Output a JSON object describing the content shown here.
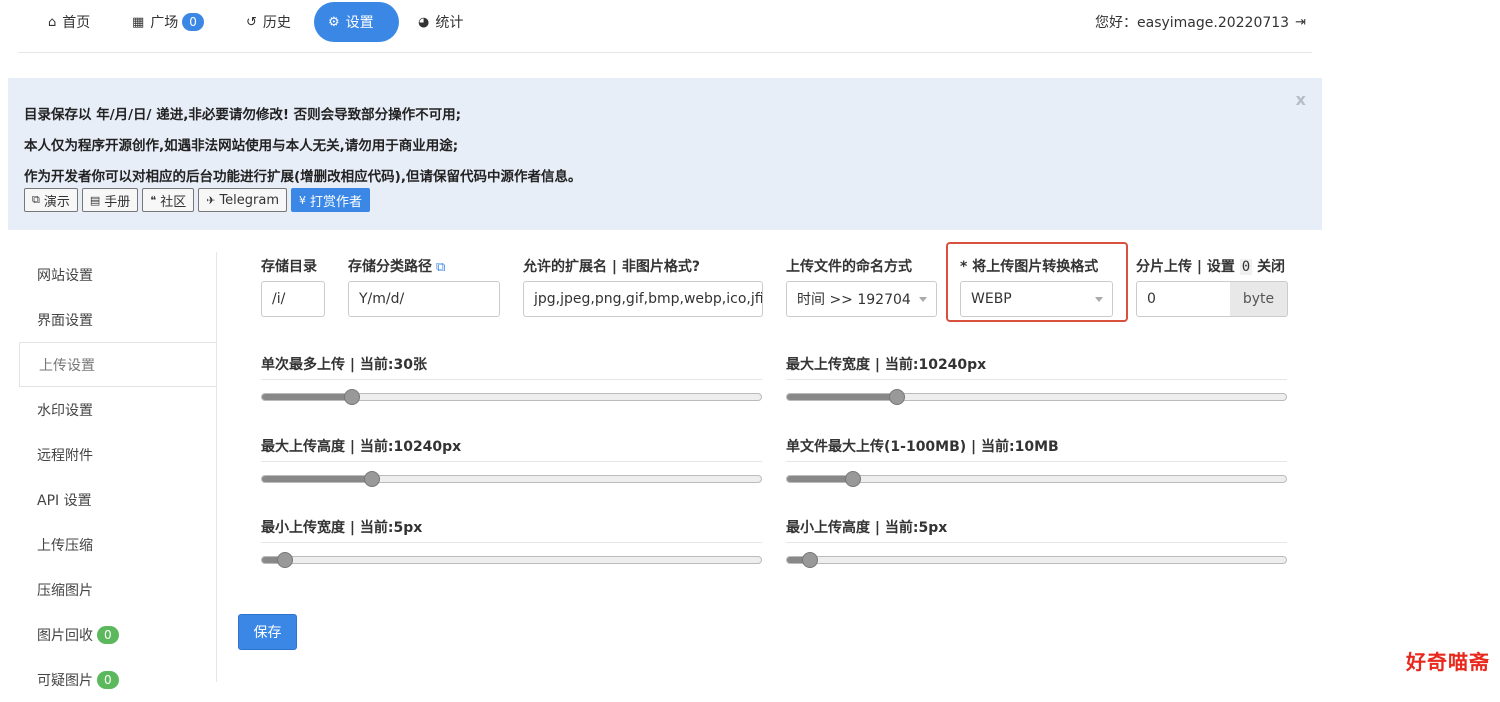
{
  "nav": {
    "items": [
      {
        "icon": "home-icon",
        "glyph": "⌂",
        "label": "首页"
      },
      {
        "icon": "grid-icon",
        "glyph": "▦",
        "label": "广场",
        "badge": "0"
      },
      {
        "icon": "history-icon",
        "glyph": "↺",
        "label": "历史"
      },
      {
        "icon": "settings-icon",
        "glyph": "⚙",
        "label": "设置",
        "active": true
      },
      {
        "icon": "pie-chart-icon",
        "glyph": "◕",
        "label": "统计"
      }
    ],
    "greeting": "您好：easyimage.20220713",
    "logout_glyph": "⇥"
  },
  "notice": {
    "lines": [
      "目录保存以 年/月/日/ 递进,非必要请勿修改! 否则会导致部分操作不可用;",
      "本人仅为程序开源创作,如遇非法网站使用与本人无关,请勿用于商业用途;",
      "作为开发者你可以对相应的后台功能进行扩展(增删改相应代码),但请保留代码中源作者信息。"
    ],
    "close": "x",
    "buttons": [
      {
        "icon": "external-link-icon",
        "glyph": "⧉",
        "label": "演示"
      },
      {
        "icon": "book-icon",
        "glyph": "▤",
        "label": "手册"
      },
      {
        "icon": "comments-icon",
        "glyph": "❝",
        "label": "社区"
      },
      {
        "icon": "plane-icon",
        "glyph": "✈",
        "label": "Telegram"
      },
      {
        "icon": "yen-icon",
        "glyph": "¥",
        "label": "打赏作者",
        "primary": true
      }
    ]
  },
  "sidebar": {
    "items": [
      "网站设置",
      "界面设置",
      "上传设置",
      "水印设置",
      "远程附件",
      "API 设置",
      "上传压缩",
      "压缩图片",
      "图片回收",
      "可疑图片"
    ],
    "active_index": 2,
    "badges": {
      "8": "0",
      "9": "0"
    }
  },
  "form": {
    "storage_dir": {
      "label": "存储目录",
      "value": "/i/"
    },
    "storage_path": {
      "label": "存储分类路径",
      "value": "Y/m/d/",
      "icon": "external-link-icon",
      "glyph": "⧉"
    },
    "extensions": {
      "label": "允许的扩展名 | 非图片格式?",
      "value": "jpg,jpeg,png,gif,bmp,webp,ico,jfif"
    },
    "naming": {
      "label": "上传文件的命名方式",
      "value": "时间 >> 192704"
    },
    "convert": {
      "label": "* 将上传图片转换格式",
      "value": "WEBP"
    },
    "chunk": {
      "label_pre": "分片上传 | 设置",
      "label_code": "0",
      "label_post": "关闭",
      "value": "0",
      "addon": "byte"
    }
  },
  "sliders": [
    {
      "label": "单次最多上传 | 当前:30张",
      "fraction": 0.17
    },
    {
      "label": "最大上传宽度 | 当前:10240px",
      "fraction": 0.21
    },
    {
      "label": "最大上传高度 | 当前:10240px",
      "fraction": 0.21
    },
    {
      "label": "单文件最大上传(1-100MB) | 当前:10MB",
      "fraction": 0.12
    },
    {
      "label": "最小上传宽度 | 当前:5px",
      "fraction": 0.03
    },
    {
      "label": "最小上传高度 | 当前:5px",
      "fraction": 0.03
    }
  ],
  "save_label": "保存",
  "watermark": "好奇喵斋",
  "colors": {
    "accent": "#3a87e6",
    "highlight": "#d9503f",
    "badge_green": "#5cb85c",
    "watermark": "#e8281c"
  }
}
